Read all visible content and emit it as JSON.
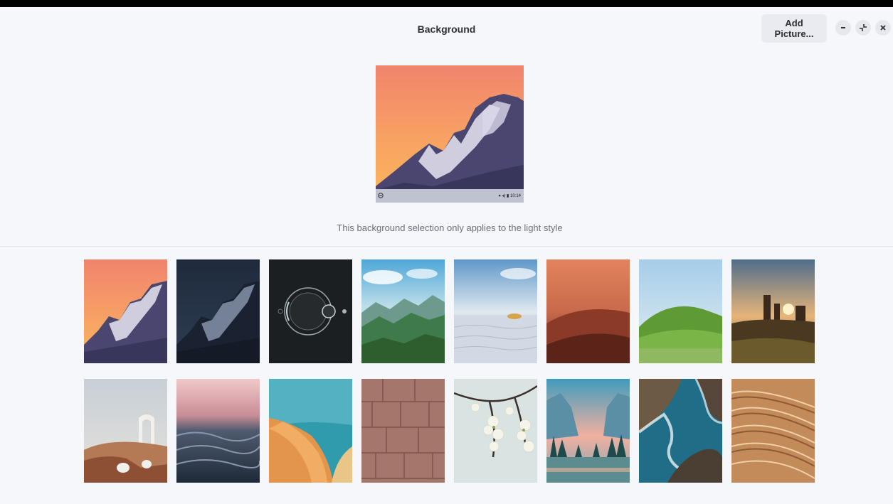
{
  "window": {
    "title": "Background",
    "add_picture_label": "Add Picture...",
    "controls": [
      "minimize-icon",
      "restore-icon",
      "close-icon"
    ]
  },
  "preview": {
    "panel_clock": "10:14",
    "panel_icons": [
      "zorin-menu-icon",
      "wifi-icon",
      "volume-icon",
      "battery-icon"
    ]
  },
  "notice": "This background selection only applies to the light style",
  "wallpapers": [
    {
      "name": "mountain-sunset"
    },
    {
      "name": "mountain-night"
    },
    {
      "name": "zorin-logo-dark"
    },
    {
      "name": "green-valley"
    },
    {
      "name": "white-sand-dunes"
    },
    {
      "name": "orange-dune"
    },
    {
      "name": "green-hills"
    },
    {
      "name": "desert-buttes-sunset"
    },
    {
      "name": "desert-arch"
    },
    {
      "name": "ocean-waves"
    },
    {
      "name": "sand-dune-coast"
    },
    {
      "name": "stone-wall"
    },
    {
      "name": "white-blossoms"
    },
    {
      "name": "mountain-lake"
    },
    {
      "name": "aerial-coast"
    },
    {
      "name": "sand-ripples"
    }
  ],
  "colors": {
    "background": "#f6f7fb",
    "button": "#e9ebf0",
    "text": "#2d2f33",
    "muted_text": "#6b6f78"
  }
}
